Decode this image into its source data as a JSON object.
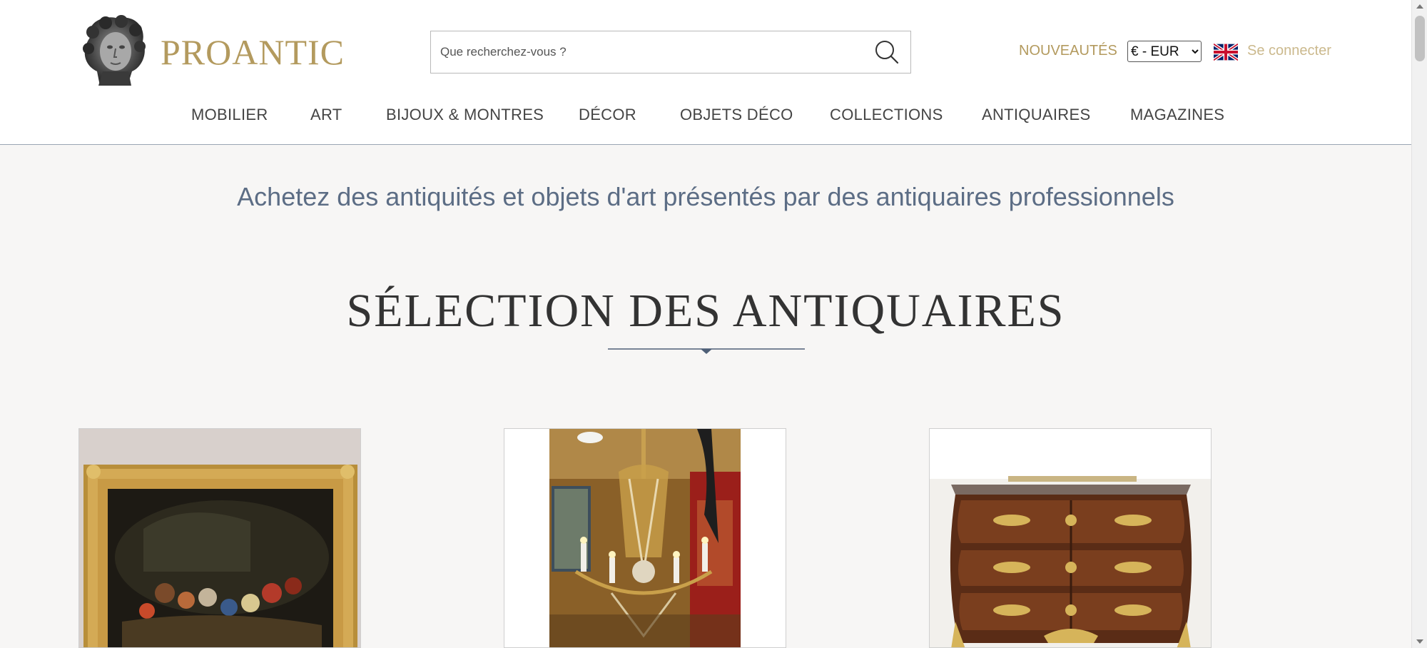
{
  "brand": {
    "name": "PROANTIC"
  },
  "search": {
    "placeholder": "Que recherchez-vous ?"
  },
  "header_links": {
    "nouveautes": "NOUVEAUTÉS",
    "currency": "€ - EUR",
    "login": "Se connecter"
  },
  "nav": {
    "items": [
      "MOBILIER",
      "ART",
      "BIJOUX & MONTRES",
      "DÉCOR",
      "OBJETS DÉCO",
      "COLLECTIONS",
      "ANTIQUAIRES",
      "MAGAZINES"
    ]
  },
  "main": {
    "tagline": "Achetez des antiquités et objets d'art présentés par des antiquaires professionnels",
    "section_title": "SÉLECTION DES ANTIQUAIRES"
  },
  "colors": {
    "gold": "#b39a5e",
    "slate": "#5c6d85",
    "background": "#f7f6f5"
  },
  "icons": [
    "logo-bust-icon",
    "search-icon",
    "uk-flag-icon",
    "divider-diamond-icon"
  ],
  "cards": [
    {
      "subject": "painting-in-gilt-frame"
    },
    {
      "subject": "crystal-chandelier"
    },
    {
      "subject": "marquetry-commode"
    }
  ]
}
